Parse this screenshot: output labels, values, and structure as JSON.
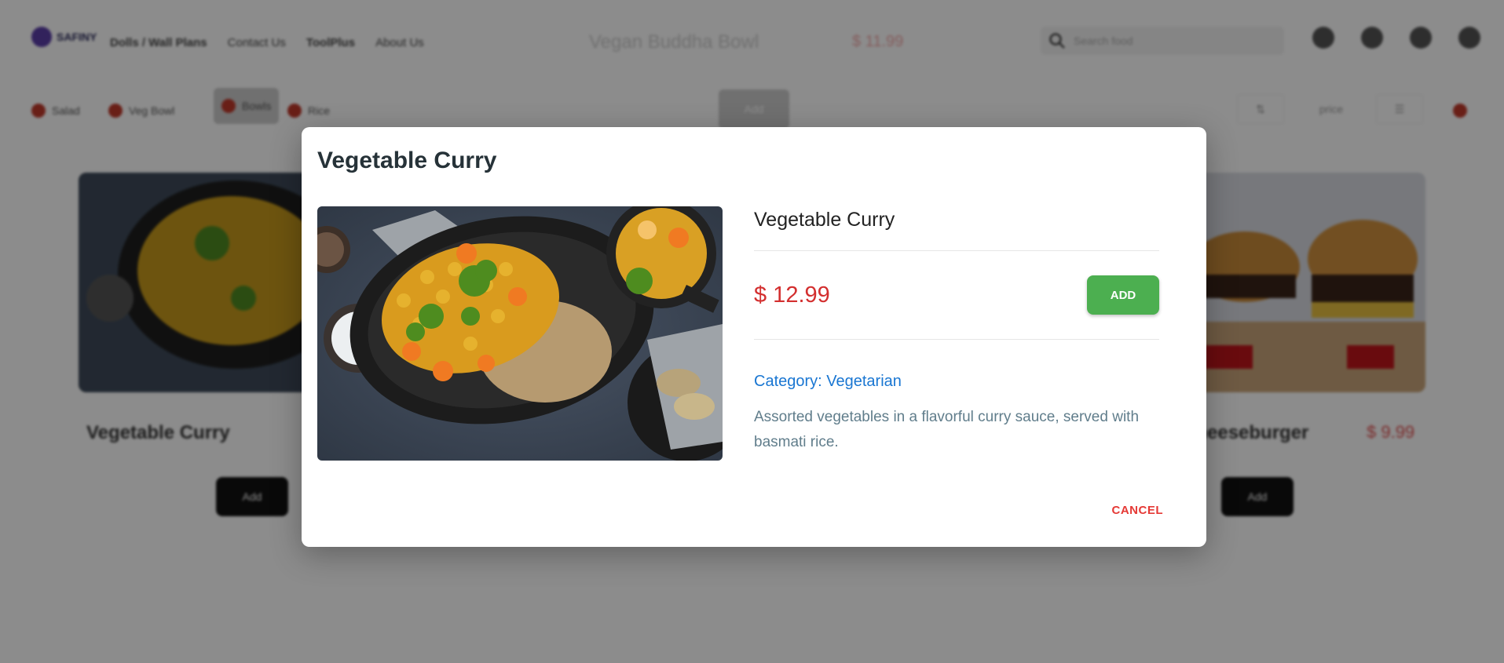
{
  "background": {
    "header": {
      "brand": "SAFINY",
      "nav": [
        "Dolls / Wall Plans",
        "Contact Us",
        "ToolPlus",
        "About Us"
      ],
      "dish_name": "Vegan Buddha Bowl",
      "dish_price": "$ 11.99",
      "search_placeholder": "Search food"
    },
    "filters": {
      "chips": [
        "Salad",
        "Veg Bowl",
        "Bowls",
        "Rice"
      ],
      "button": "Add",
      "right_label": "price"
    },
    "cards": [
      {
        "title": "Vegetable Curry",
        "button": "Add"
      },
      {
        "title": "Cheeseburger",
        "price": "$ 9.99",
        "button": "Add"
      }
    ]
  },
  "modal": {
    "title": "Vegetable Curry",
    "product_name": "Vegetable Curry",
    "price": "$ 12.99",
    "add_label": "ADD",
    "category": "Category: Vegetarian",
    "description": "Assorted vegetables in a flavorful curry sauce, served with basmati rice.",
    "cancel_label": "CANCEL"
  },
  "colors": {
    "price_red": "#d32f2f",
    "add_green": "#4caf50",
    "category_blue": "#1976d2",
    "cancel_red": "#e53935"
  }
}
